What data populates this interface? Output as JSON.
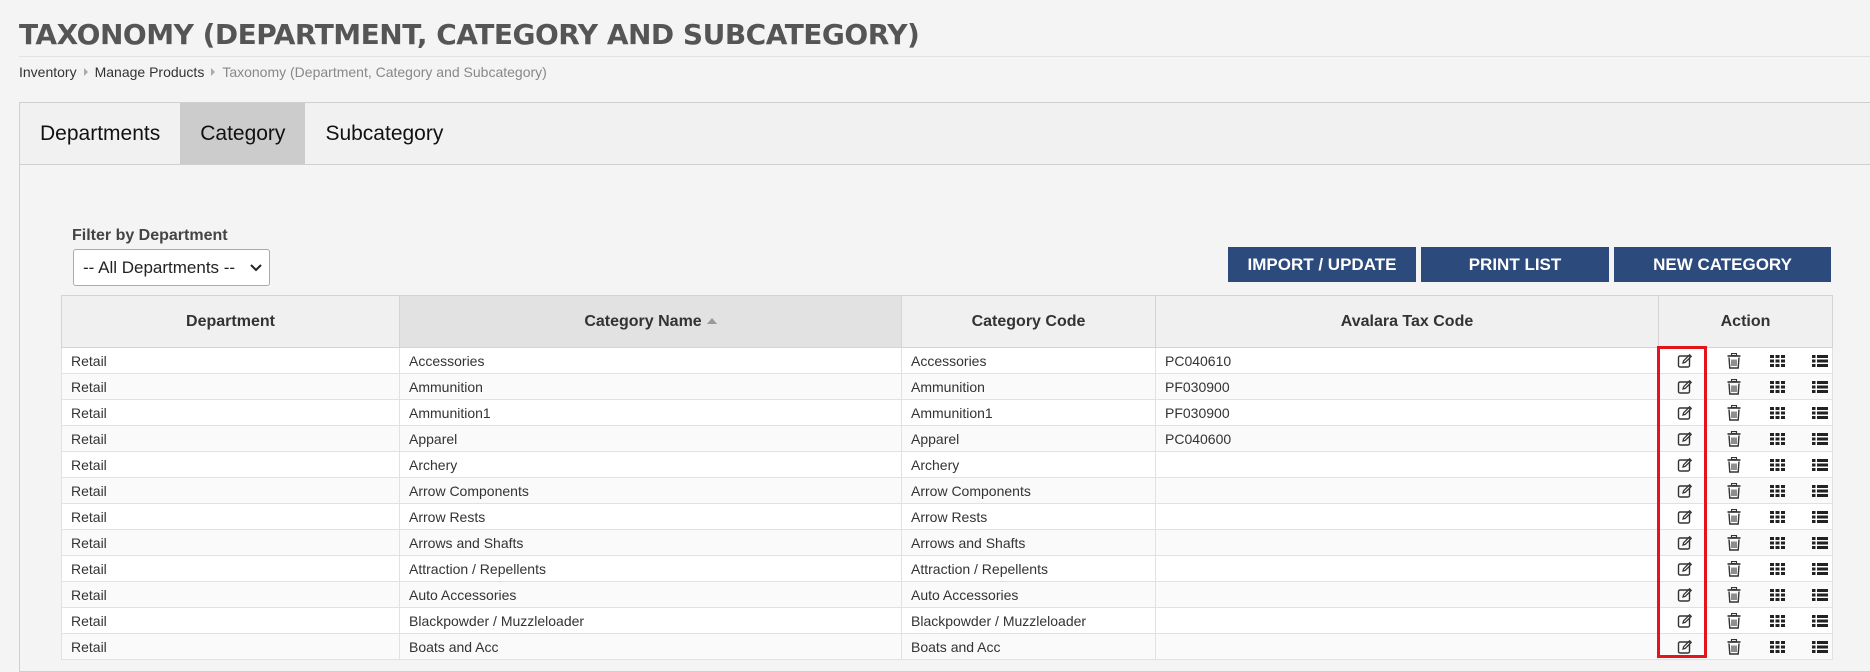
{
  "page": {
    "title": "TAXONOMY (DEPARTMENT, CATEGORY AND SUBCATEGORY)"
  },
  "breadcrumb": [
    "Inventory",
    "Manage Products",
    "Taxonomy (Department, Category and Subcategory)"
  ],
  "tabs": [
    {
      "label": "Departments"
    },
    {
      "label": "Category",
      "active": true
    },
    {
      "label": "Subcategory"
    }
  ],
  "filter": {
    "label": "Filter by Department",
    "selected": "-- All Departments --"
  },
  "buttons": {
    "import": "IMPORT / UPDATE",
    "print": "PRINT LIST",
    "new": "NEW CATEGORY"
  },
  "table": {
    "columns": [
      "Department",
      "Category Name",
      "Category Code",
      "Avalara Tax Code",
      "Action"
    ],
    "sorted_column": "Category Name",
    "rows": [
      {
        "department": "Retail",
        "name": "Accessories",
        "code": "Accessories",
        "tax": "PC040610"
      },
      {
        "department": "Retail",
        "name": "Ammunition",
        "code": "Ammunition",
        "tax": "PF030900"
      },
      {
        "department": "Retail",
        "name": "Ammunition1",
        "code": "Ammunition1",
        "tax": "PF030900"
      },
      {
        "department": "Retail",
        "name": "Apparel",
        "code": "Apparel",
        "tax": "PC040600"
      },
      {
        "department": "Retail",
        "name": "Archery",
        "code": "Archery",
        "tax": ""
      },
      {
        "department": "Retail",
        "name": "Arrow Components",
        "code": "Arrow Components",
        "tax": ""
      },
      {
        "department": "Retail",
        "name": "Arrow Rests",
        "code": "Arrow Rests",
        "tax": ""
      },
      {
        "department": "Retail",
        "name": "Arrows and Shafts",
        "code": "Arrows and Shafts",
        "tax": ""
      },
      {
        "department": "Retail",
        "name": "Attraction / Repellents",
        "code": "Attraction / Repellents",
        "tax": ""
      },
      {
        "department": "Retail",
        "name": "Auto Accessories",
        "code": "Auto Accessories",
        "tax": ""
      },
      {
        "department": "Retail",
        "name": "Blackpowder / Muzzleloader",
        "code": "Blackpowder / Muzzleloader",
        "tax": ""
      },
      {
        "department": "Retail",
        "name": "Boats and Acc",
        "code": "Boats and Acc",
        "tax": ""
      }
    ],
    "action_icons": [
      "edit-icon",
      "delete-icon",
      "grid-icon",
      "list-icon"
    ]
  },
  "colors": {
    "button_bg": "#2c4a7c",
    "highlight": "#e3141c",
    "active_tab": "#cccccc"
  }
}
